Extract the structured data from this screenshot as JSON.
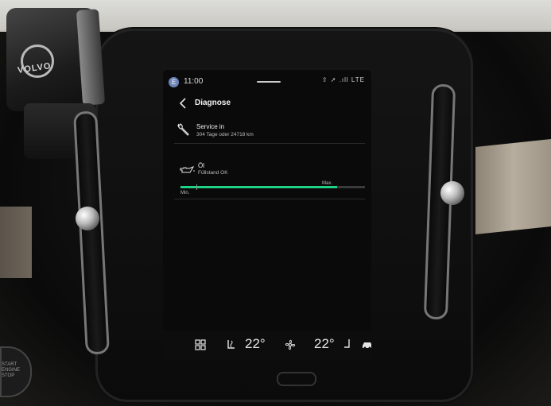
{
  "status_bar": {
    "avatar_letter": "E",
    "time": "11:00",
    "icons_text": "⇧ ➚ .ıll LTE"
  },
  "header": {
    "title": "Diagnose",
    "back_icon": "chevron-left-icon"
  },
  "service": {
    "title": "Service in",
    "detail": "304 Tage oder 24718 km",
    "icon": "wrench-icon"
  },
  "oil": {
    "title": "Öl",
    "detail": "Füllstand OK",
    "level_percent": 85,
    "min_label": "Min.",
    "max_label": "Max.",
    "icon": "oil-can-icon",
    "accent_color": "#1fd183"
  },
  "climate": {
    "left_temp": "22°",
    "right_temp": "22°",
    "icons": [
      "grid-icon",
      "seat-heat-left-icon",
      "fan-icon",
      "seat-heat-right-icon",
      "car-icon"
    ]
  },
  "car": {
    "brand_badge": "VOLVO",
    "stop_button_text": "START ENGINE STOP"
  }
}
